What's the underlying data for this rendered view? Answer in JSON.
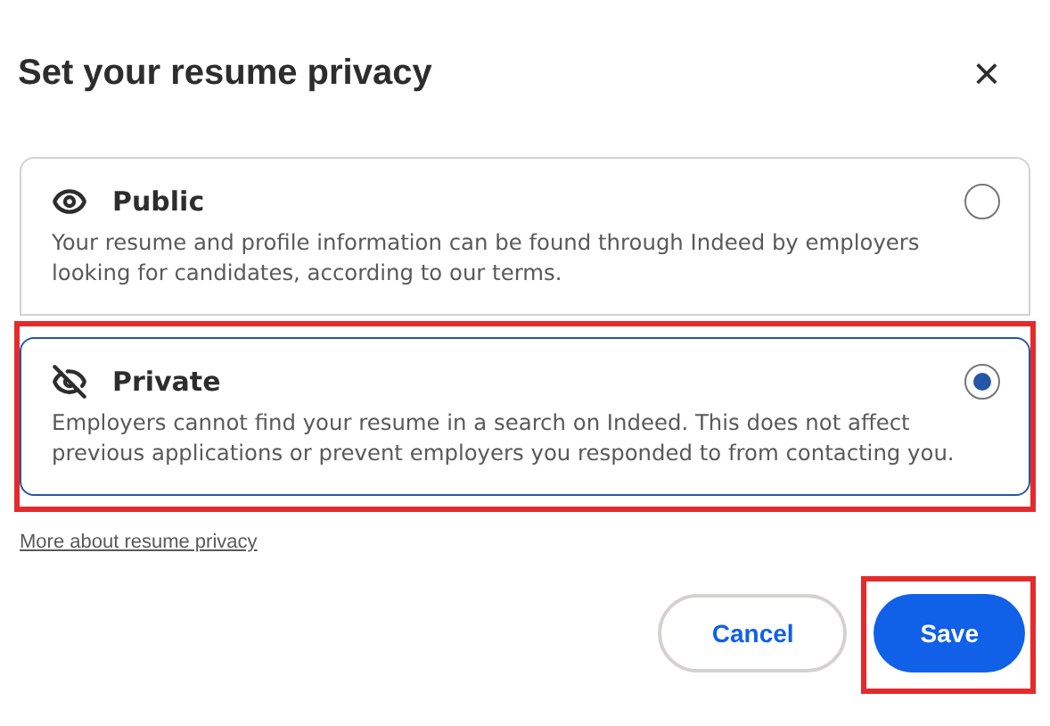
{
  "dialog": {
    "title": "Set your resume privacy",
    "close": "×"
  },
  "options": [
    {
      "kind": "public",
      "label": "Public",
      "description": "Your resume and profile information can be found through Indeed by employers looking for candidates, according to our terms.",
      "selected": false,
      "highlighted": false
    },
    {
      "kind": "private",
      "label": "Private",
      "description": "Employers cannot find your resume in a search on Indeed. This does not affect previous applications or prevent employers you responded to from contacting you.",
      "selected": true,
      "highlighted": true
    }
  ],
  "link": "More about resume privacy",
  "buttons": [
    {
      "kind": "secondary",
      "label": "Cancel",
      "highlighted": false
    },
    {
      "kind": "primary",
      "label": "Save",
      "highlighted": true
    }
  ]
}
